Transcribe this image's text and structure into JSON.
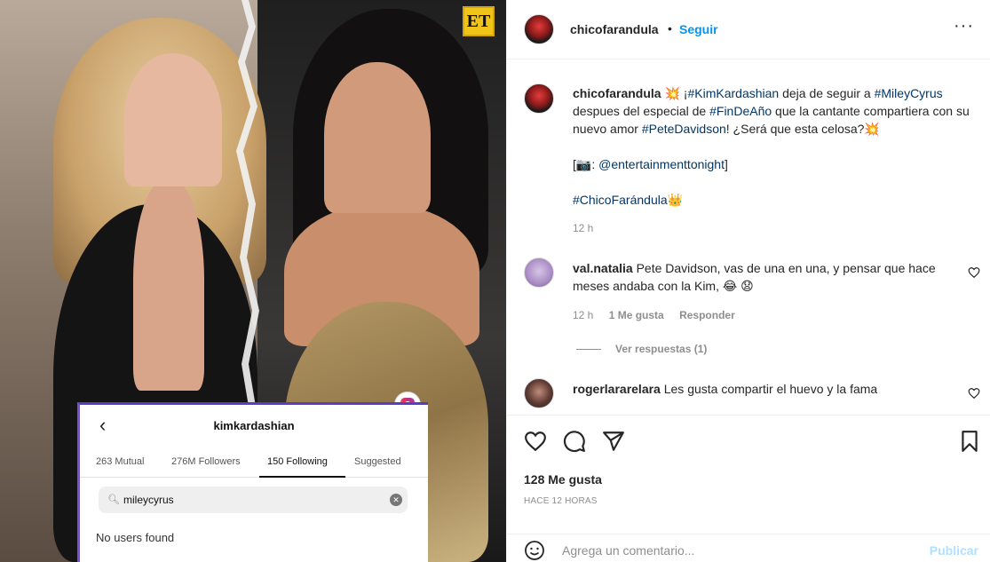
{
  "photo": {
    "et_logo": "ET",
    "ig_card": {
      "username": "kimkardashian",
      "tabs": [
        "263 Mutual",
        "276M Followers",
        "150 Following",
        "Suggested"
      ],
      "active_tab": "150 Following",
      "search_value": "mileycyrus",
      "empty_message": "No users found"
    }
  },
  "post": {
    "header": {
      "username": "chicofarandula",
      "separator": "•",
      "follow_label": "Seguir",
      "more_label": "···"
    },
    "caption": {
      "username": "chicofarandula",
      "line1_pre": " 💥 ¡",
      "tag1": "#KimKardashian",
      "line1_mid": " deja de seguir a ",
      "tag2": "#MileyCyrus",
      "line2_pre": " despues del especial de ",
      "tag3": "#FinDeAño",
      "line2_mid": " que la cantante compartiera con su nuevo amor ",
      "tag4": "#PeteDavidson",
      "line2_post": "! ¿Será que esta celosa?💥",
      "credit_pre": "[📷: ",
      "credit_tag": "@entertainmenttonight",
      "credit_post": "]",
      "signature_tag": "#ChicoFarándula",
      "signature_emoji": "👑",
      "time": "12 h"
    },
    "comments": [
      {
        "username": "val.natalia",
        "text": " Pete Davidson, vas de una en una, y pensar que hace meses andaba con la Kim, 😂 😧",
        "time": "12 h",
        "likes": "1 Me gusta",
        "reply_label": "Responder",
        "view_replies": "Ver respuestas (1)"
      },
      {
        "username": "rogerlararelara",
        "text": " Les gusta compartir el huevo y la fama"
      }
    ],
    "likes_label": "128 Me gusta",
    "ago_label": "HACE 12 HORAS",
    "composer": {
      "placeholder": "Agrega un comentario...",
      "publish_label": "Publicar"
    },
    "icons": {
      "like": "heart-icon",
      "comment": "comment-icon",
      "share": "share-icon",
      "save": "bookmark-icon",
      "emoji": "emoji-icon"
    }
  }
}
